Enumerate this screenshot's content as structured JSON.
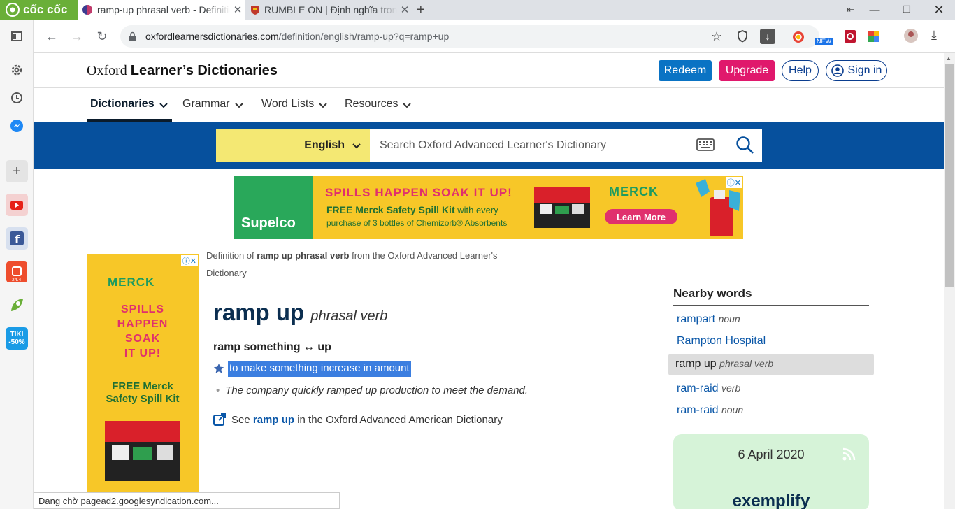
{
  "browser": {
    "brand": "cốc cốc",
    "tabs": [
      {
        "title": "ramp-up phrasal verb - Definition",
        "active": true
      },
      {
        "title": "RUMBLE ON | Định nghĩa trong",
        "active": false
      }
    ],
    "url_domain": "oxfordlearnersdictionaries.com",
    "url_path": "/definition/english/ramp-up?q=ramp+up",
    "status_text": "Đang chờ pagead2.googlesyndication.com..."
  },
  "site": {
    "logo_regular": "Oxford",
    "logo_bold": "Learner’s Dictionaries",
    "buttons": {
      "redeem": "Redeem",
      "upgrade": "Upgrade",
      "help": "Help",
      "signin": "Sign in"
    },
    "menu": [
      "Dictionaries",
      "Grammar",
      "Word Lists",
      "Resources"
    ]
  },
  "search": {
    "language": "English",
    "placeholder": "Search Oxford Advanced Learner's Dictionary"
  },
  "ads": {
    "top": {
      "brand_left": "Supelco",
      "headline": "SPILLS HAPPEN SOAK IT UP!",
      "offer_bold": "FREE Merck Safety Spill Kit",
      "offer_rest": " with every",
      "offer_line2": "purchase of 3 bottles of Chemizorb® Absorbents",
      "brand_right": "MERCK",
      "cta": "Learn More"
    },
    "side": {
      "brand": "MERCK",
      "headline": [
        "SPILLS",
        "HAPPEN",
        "SOAK",
        "IT UP!"
      ],
      "offer": [
        "FREE Merck",
        "Safety Spill Kit"
      ]
    }
  },
  "entry": {
    "source_prefix": "Definition of ",
    "source_bold": "ramp up phrasal verb",
    "source_suffix": " from the Oxford Advanced Learner's Dictionary",
    "headword": "ramp up",
    "pos": "phrasal verb",
    "pattern": "ramp something ↔ up",
    "definition": "to make something increase in amount",
    "example": "The company quickly ramped up production to meet the demand.",
    "see_prefix": "See ",
    "see_link": "ramp up",
    "see_suffix": " in the Oxford Advanced American Dictionary"
  },
  "nearby": {
    "heading": "Nearby words",
    "items": [
      {
        "word": "rampart",
        "pos": "noun"
      },
      {
        "word": "Rampton Hospital",
        "pos": ""
      },
      {
        "word": "ramp up",
        "pos": "phrasal verb",
        "selected": true
      },
      {
        "word": "ram-raid",
        "pos": "verb"
      },
      {
        "word": "ram-raid",
        "pos": "noun"
      }
    ]
  },
  "word_of_the_day": {
    "date": "6 April 2020",
    "word": "exemplify"
  },
  "colors": {
    "band": "#06509d",
    "language_box": "#f4e873",
    "redeem": "#0a73c4",
    "upgrade": "#e0186c",
    "selection": "#3b7ee0"
  }
}
